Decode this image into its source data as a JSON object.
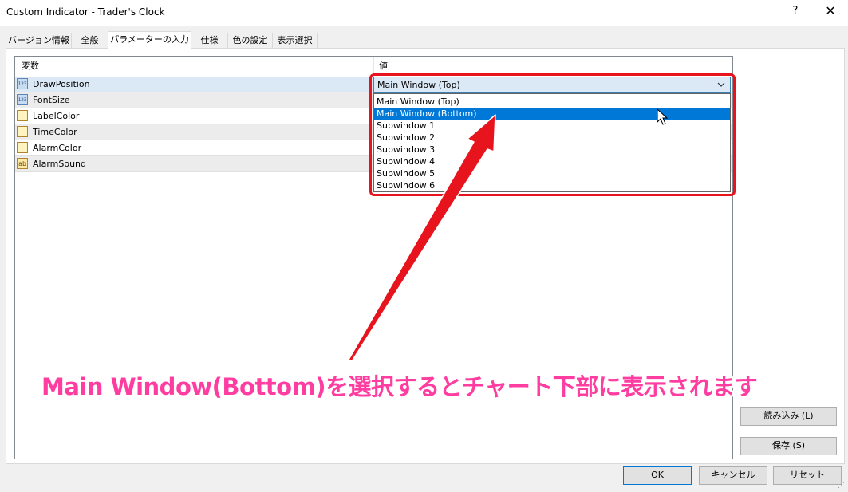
{
  "window": {
    "title": "Custom Indicator - Trader's Clock",
    "help_label": "?",
    "close_label": "✕"
  },
  "tabs": [
    {
      "label": "バージョン情報",
      "active": false
    },
    {
      "label": "全般",
      "active": false
    },
    {
      "label": "パラメーターの入力",
      "active": true
    },
    {
      "label": "仕様",
      "active": false
    },
    {
      "label": "色の設定",
      "active": false
    },
    {
      "label": "表示選択",
      "active": false
    }
  ],
  "grid": {
    "columns": [
      "変数",
      "値"
    ],
    "rows": [
      {
        "name": "DrawPosition",
        "icon": "number-icon",
        "icon_text": "123"
      },
      {
        "name": "FontSize",
        "icon": "number-icon",
        "icon_text": "123"
      },
      {
        "name": "LabelColor",
        "icon": "color-icon",
        "icon_text": ""
      },
      {
        "name": "TimeColor",
        "icon": "color-icon",
        "icon_text": ""
      },
      {
        "name": "AlarmColor",
        "icon": "color-icon",
        "icon_text": ""
      },
      {
        "name": "AlarmSound",
        "icon": "text-icon",
        "icon_text": "ab"
      }
    ]
  },
  "combo": {
    "selected_value": "Main Window (Top)",
    "options": [
      "Main Window (Top)",
      "Main Window (Bottom)",
      "Subwindow 1",
      "Subwindow 2",
      "Subwindow 3",
      "Subwindow 4",
      "Subwindow 5",
      "Subwindow 6"
    ],
    "highlighted_index": 1
  },
  "annotation": {
    "text": "Main Window(Bottom)を選択するとチャート下部に表示されます",
    "color": "#ff3ca0",
    "arrow_color": "#e8141d"
  },
  "side_buttons": {
    "load_label": "読み込み (L)",
    "save_label": "保存 (S)"
  },
  "footer_buttons": {
    "ok_label": "OK",
    "cancel_label": "キャンセル",
    "reset_label": "リセット"
  }
}
